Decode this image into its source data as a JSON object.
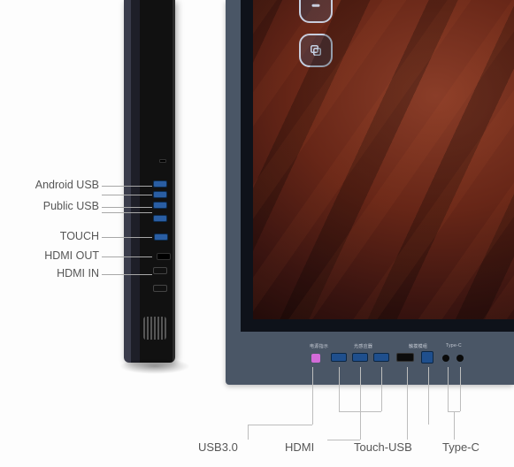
{
  "side_labels": {
    "android_usb": "Android USB",
    "public_usb": "Public USB",
    "touch": "TOUCH",
    "hdmi_out": "HDMI OUT",
    "hdmi_in": "HDMI IN"
  },
  "bottom_labels": {
    "usb30": "USB3.0",
    "hdmi": "HDMI",
    "touch_usb": "Touch-USB",
    "typec": "Type-C"
  },
  "chin_tiny": {
    "a": "电源指示",
    "b": "光感应器",
    "c": "触摸模组",
    "d": "Type-C"
  }
}
